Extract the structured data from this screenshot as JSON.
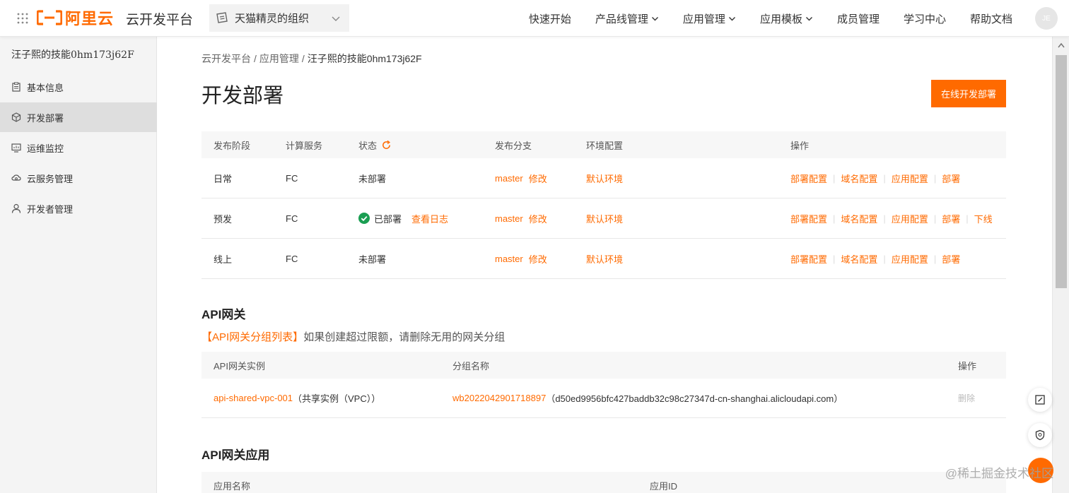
{
  "topbar": {
    "brand": "阿里云",
    "platform_title": "云开发平台",
    "org_select": "天猫精灵的组织",
    "nav": [
      {
        "label": "快速开始",
        "dropdown": false
      },
      {
        "label": "产品线管理",
        "dropdown": true
      },
      {
        "label": "应用管理",
        "dropdown": true
      },
      {
        "label": "应用模板",
        "dropdown": true
      },
      {
        "label": "成员管理",
        "dropdown": false
      },
      {
        "label": "学习中心",
        "dropdown": false
      },
      {
        "label": "帮助文档",
        "dropdown": false
      }
    ],
    "avatar_initials": "JE"
  },
  "sidebar": {
    "app_name": "汪子熙的技能0hm173j62F",
    "items": [
      {
        "label": "基本信息",
        "icon": "clipboard-icon"
      },
      {
        "label": "开发部署",
        "icon": "cube-icon",
        "active": true
      },
      {
        "label": "运维监控",
        "icon": "monitor-icon"
      },
      {
        "label": "云服务管理",
        "icon": "cloud-icon"
      },
      {
        "label": "开发者管理",
        "icon": "user-icon"
      }
    ]
  },
  "main": {
    "breadcrumb": [
      "云开发平台",
      "应用管理",
      "汪子熙的技能0hm173j62F"
    ],
    "breadcrumb_sep": "/",
    "page_title": "开发部署",
    "deploy_online_button": "在线开发部署",
    "deploy_table": {
      "headers": {
        "stage": "发布阶段",
        "compute": "计算服务",
        "status": "状态",
        "branch": "发布分支",
        "env": "环境配置",
        "ops": "操作"
      },
      "rows": [
        {
          "stage": "日常",
          "compute": "FC",
          "status": "未部署",
          "deployed": false,
          "log": "",
          "branch": "master",
          "edit": "修改",
          "env": "默认环境",
          "ops": [
            "部署配置",
            "域名配置",
            "应用配置",
            "部署"
          ]
        },
        {
          "stage": "预发",
          "compute": "FC",
          "status": "已部署",
          "deployed": true,
          "log": "查看日志",
          "branch": "master",
          "edit": "修改",
          "env": "默认环境",
          "ops": [
            "部署配置",
            "域名配置",
            "应用配置",
            "部署",
            "下线"
          ]
        },
        {
          "stage": "线上",
          "compute": "FC",
          "status": "未部署",
          "deployed": false,
          "log": "",
          "branch": "master",
          "edit": "修改",
          "env": "默认环境",
          "ops": [
            "部署配置",
            "域名配置",
            "应用配置",
            "部署"
          ]
        }
      ]
    },
    "api_gateway": {
      "title": "API网关",
      "tip_link": "【API网关分组列表】",
      "tip_text": "如果创建超过限额，请删除无用的网关分组",
      "headers": {
        "instance": "API网关实例",
        "group": "分组名称",
        "ops": "操作"
      },
      "rows": [
        {
          "instance": "api-shared-vpc-001",
          "instance_suffix": "（共享实例（VPC））",
          "group": "wb2022042901718897",
          "group_domain": "（d50ed9956bfc427baddb32c98c27347d-cn-shanghai.alicloudapi.com）",
          "op": "删除"
        }
      ]
    },
    "api_gateway_app": {
      "title": "API网关应用",
      "headers": {
        "name": "应用名称",
        "id": "应用ID"
      }
    }
  },
  "watermark": "@稀土掘金技术社区",
  "colors": {
    "accent": "#ff6a00",
    "success": "#1a9e52",
    "sidebar_bg": "#f4f4f4",
    "sidebar_active": "#dedede"
  }
}
